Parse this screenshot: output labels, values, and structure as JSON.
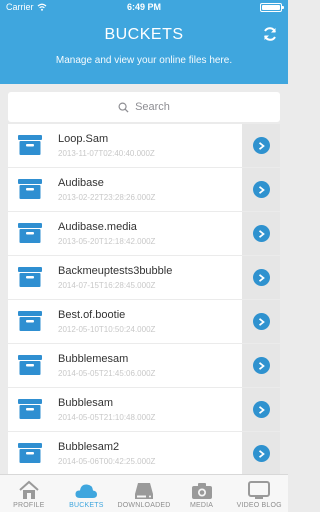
{
  "status": {
    "carrier": "Carrier",
    "time": "6:49 PM"
  },
  "header": {
    "title": "BUCKETS",
    "subtitle": "Manage and view your online files here."
  },
  "search": {
    "placeholder": "Search"
  },
  "buckets": [
    {
      "name": "Loop.Sam",
      "date": "2013-11-07T02:40:40.000Z"
    },
    {
      "name": "Audibase",
      "date": "2013-02-22T23:28:26.000Z"
    },
    {
      "name": "Audibase.media",
      "date": "2013-05-20T12:18:42.000Z"
    },
    {
      "name": "Backmeuptests3bubble",
      "date": "2014-07-15T16:28:45.000Z"
    },
    {
      "name": "Best.of.bootie",
      "date": "2012-05-10T10:50:24.000Z"
    },
    {
      "name": "Bubblemesam",
      "date": "2014-05-05T21:45:06.000Z"
    },
    {
      "name": "Bubblesam",
      "date": "2014-05-05T21:10:48.000Z"
    },
    {
      "name": "Bubblesam2",
      "date": "2014-05-06T00:42:25.000Z"
    }
  ],
  "tabs": [
    {
      "label": "PROFILE",
      "icon": "house-icon",
      "active": false
    },
    {
      "label": "BUCKETS",
      "icon": "cloud-icon",
      "active": true
    },
    {
      "label": "DOWNLOADED",
      "icon": "drive-icon",
      "active": false
    },
    {
      "label": "MEDIA",
      "icon": "camera-icon",
      "active": false
    },
    {
      "label": "VIDEO BLOG",
      "icon": "tv-icon",
      "active": false
    }
  ],
  "colors": {
    "accent": "#3fa6de",
    "chevron": "#2f92cf",
    "folder": "#2f8fd1"
  }
}
